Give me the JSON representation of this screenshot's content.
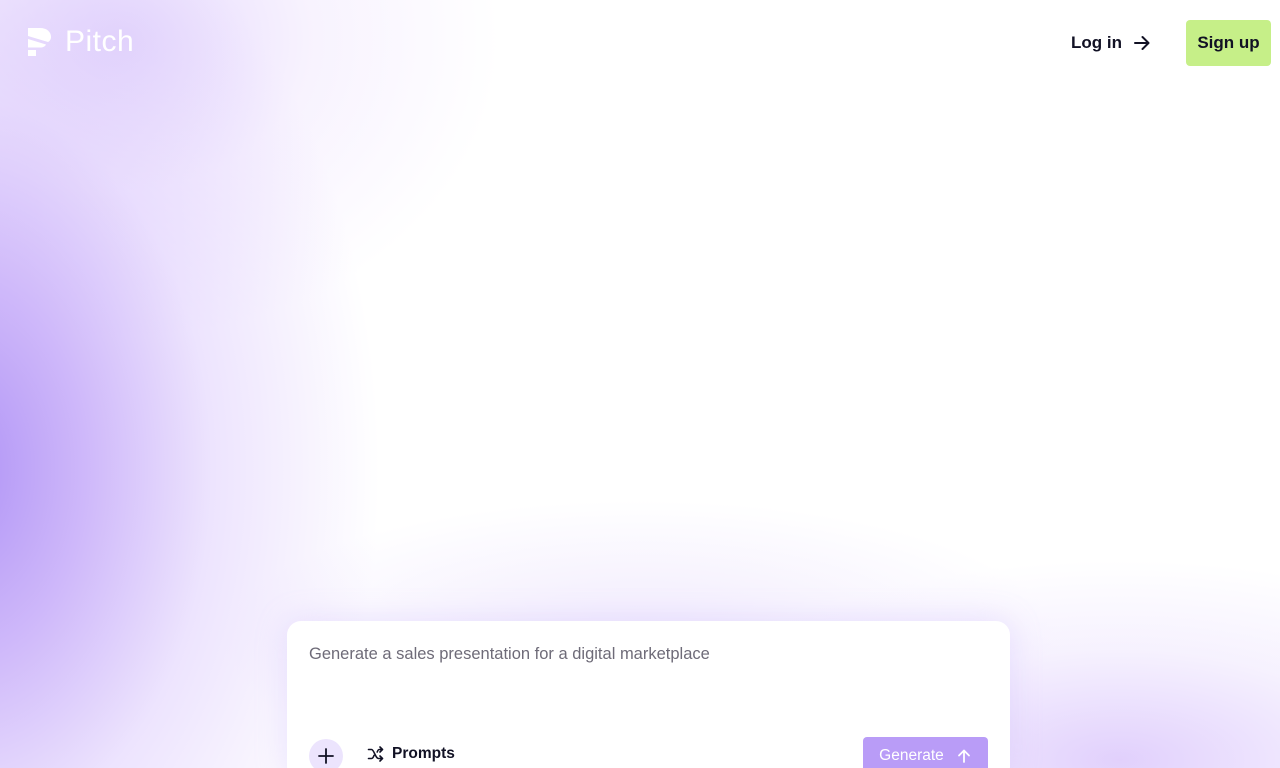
{
  "header": {
    "brand": "Pitch",
    "login_label": "Log in",
    "signup_label": "Sign up"
  },
  "prompt": {
    "placeholder": "Generate a sales presentation for a digital marketplace",
    "prompts_label": "Prompts",
    "generate_label": "Generate"
  },
  "icons": {
    "logo": "pitch-logo-icon",
    "login": "arrow-right-icon",
    "add": "plus-icon",
    "prompts": "shuffle-icon",
    "generate": "arrow-up-icon"
  },
  "colors": {
    "signup_bg": "#c6ef88",
    "generate_bg": "#b99cf7",
    "text_dark": "#111124",
    "accent_purple": "#a98bf5"
  }
}
